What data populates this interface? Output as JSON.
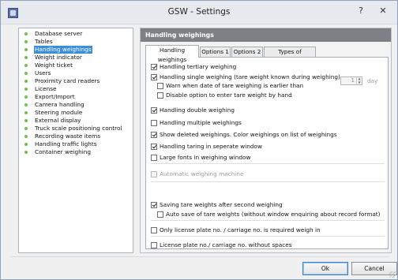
{
  "window": {
    "title": "GSW - Settings",
    "help_glyph": "?",
    "close_glyph": "✕"
  },
  "sidebar": {
    "items": [
      {
        "label": "Database server"
      },
      {
        "label": "Tables"
      },
      {
        "label": "Handling weighings",
        "selected": true
      },
      {
        "label": "Weight indicator"
      },
      {
        "label": "Weight ticket"
      },
      {
        "label": "Users"
      },
      {
        "label": "Proximity card readers"
      },
      {
        "label": "License"
      },
      {
        "label": "Export/Import"
      },
      {
        "label": "Camera handling"
      },
      {
        "label": "Steering module"
      },
      {
        "label": "External display"
      },
      {
        "label": "Truck scale positioning control"
      },
      {
        "label": "Recording waste items"
      },
      {
        "label": "Handling traffic lights"
      },
      {
        "label": "Container weighing"
      }
    ]
  },
  "panel": {
    "header": "Handling weighings",
    "tabs": [
      {
        "label": "Handling weighings",
        "active": true
      },
      {
        "label": "Options 1"
      },
      {
        "label": "Options 2"
      },
      {
        "label": "Types of weighing"
      }
    ],
    "options": {
      "tertiary": {
        "label": "Handling tertiary weighing",
        "checked": true
      },
      "single": {
        "label": "Handling single weighing (tare weight known during weighing)",
        "checked": true
      },
      "warn": {
        "label": "Warn when date of tare weighing is earlier than",
        "checked": false
      },
      "disable_tare": {
        "label": "Disable option to enter tare weight by hand",
        "checked": false
      },
      "double": {
        "label": "Handling double weighing",
        "checked": true
      },
      "multiple": {
        "label": "Handling multiple weighings",
        "checked": false
      },
      "show_deleted": {
        "label": "Show deleted weighings. Color weighings on list of weighings",
        "checked": true
      },
      "taring_window": {
        "label": "Handling taring in seperate window",
        "checked": true
      },
      "large_fonts": {
        "label": "Large fonts in weighing window",
        "checked": false
      },
      "auto_machine": {
        "label": "Automatic weighing machine",
        "checked": false,
        "disabled": true
      },
      "saving_tare": {
        "label": "Saving tare weights after second weighing",
        "checked": true
      },
      "auto_save": {
        "label": "Auto save of tare weights (without window enquiring about record format)",
        "checked": false
      },
      "plate_required": {
        "label": "Only license plate no. / carriage no. is required weigh in",
        "checked": false
      },
      "plate_no_spaces": {
        "label": "License plate no./ carriage no. without spaces",
        "checked": false
      }
    },
    "days_value": "1",
    "days_unit": "day"
  },
  "footer": {
    "ok_label": "Ok",
    "cancel_label": "Cancel"
  },
  "colors": {
    "selection": "#3a8edb",
    "bullet": "#6cc24a",
    "header_bg": "#7d8186"
  }
}
